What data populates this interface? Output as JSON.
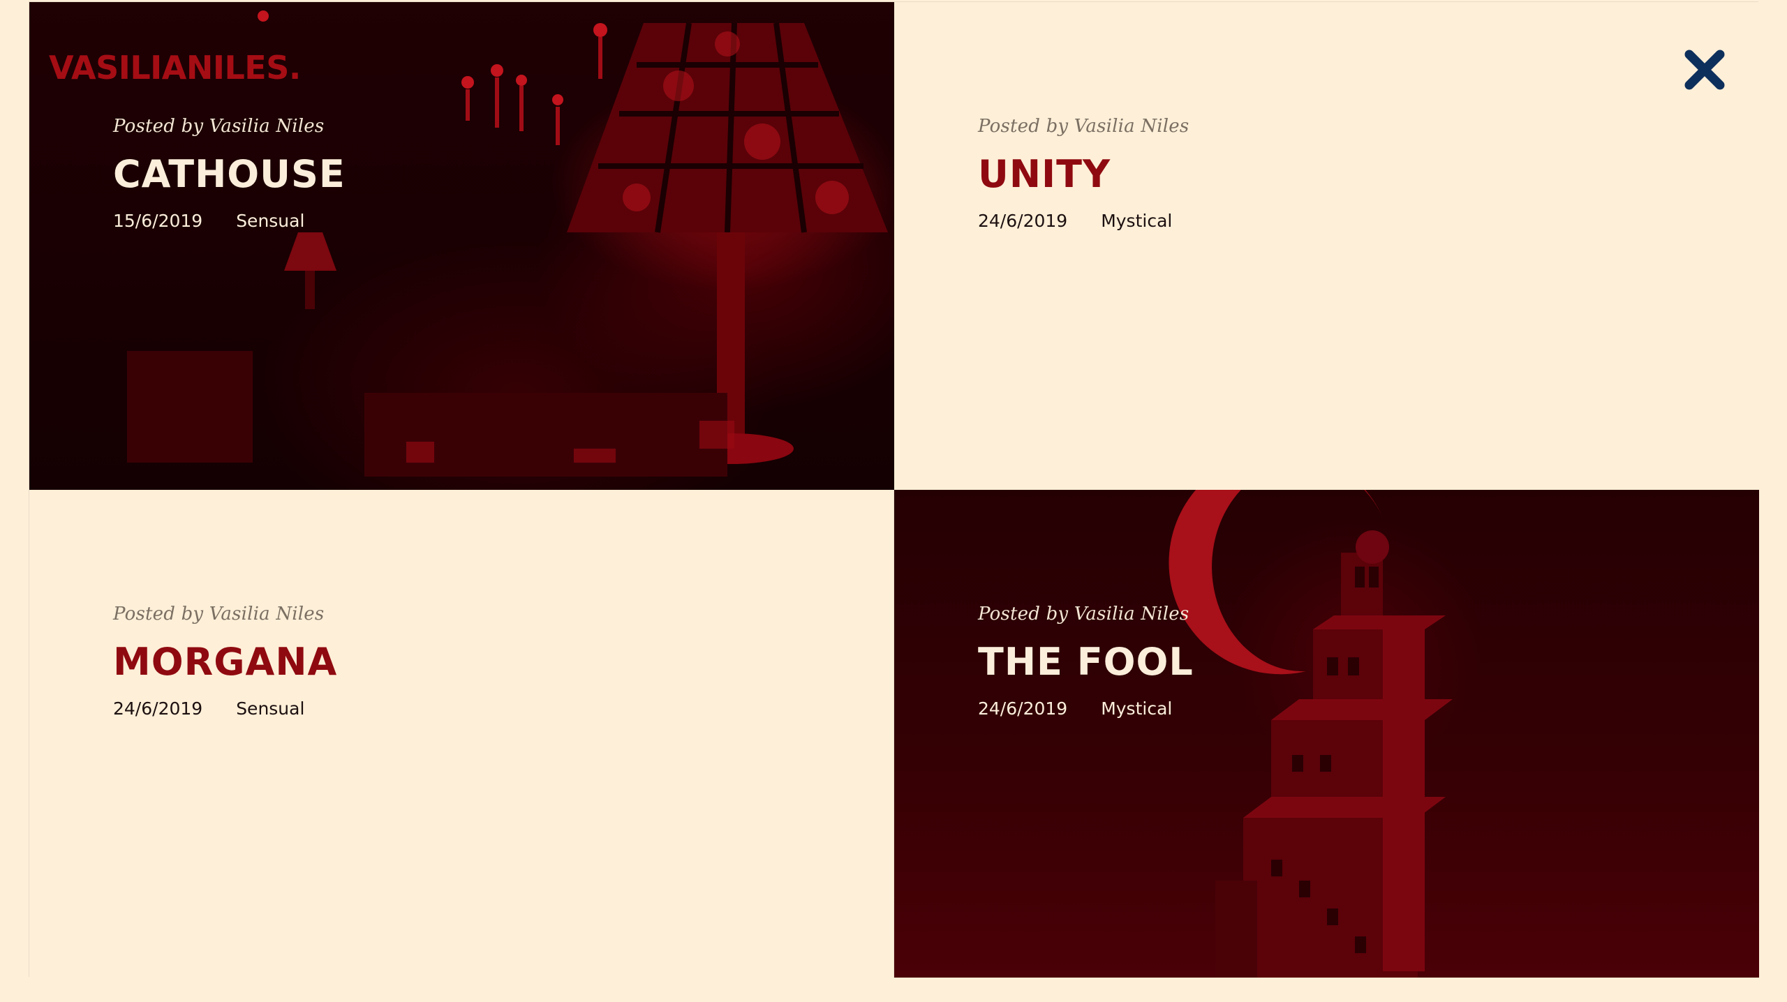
{
  "brand": {
    "logo": "VASILIANILES."
  },
  "controls": {
    "close_icon": "close-icon"
  },
  "posts": [
    {
      "posted_by": "Posted by Vasilia Niles",
      "title": "CATHOUSE",
      "date": "15/6/2019",
      "tag": "Sensual",
      "theme": "dark"
    },
    {
      "posted_by": "Posted by Vasilia Niles",
      "title": "UNITY",
      "date": "24/6/2019",
      "tag": "Mystical",
      "theme": "light"
    },
    {
      "posted_by": "Posted by Vasilia Niles",
      "title": "MORGANA",
      "date": "24/6/2019",
      "tag": "Sensual",
      "theme": "light"
    },
    {
      "posted_by": "Posted by Vasilia Niles",
      "title": "THE FOOL",
      "date": "24/6/2019",
      "tag": "Mystical",
      "theme": "dark"
    }
  ],
  "colors": {
    "background": "#feefd8",
    "accent": "#8f0a10",
    "close": "#0d2f5c",
    "dark_card": "#1f0003"
  }
}
